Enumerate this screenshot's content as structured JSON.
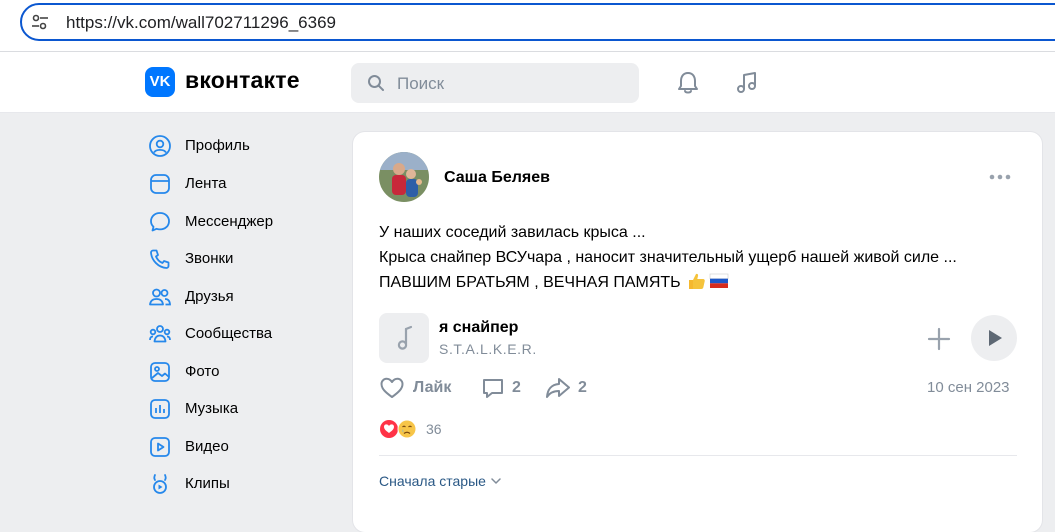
{
  "browser": {
    "url": "https://vk.com/wall702711296_6369"
  },
  "header": {
    "logo_letters": "VK",
    "brand": "вконтакте",
    "search_placeholder": "Поиск"
  },
  "sidebar": {
    "items": [
      {
        "label": "Профиль",
        "icon": "profile-icon"
      },
      {
        "label": "Лента",
        "icon": "feed-icon"
      },
      {
        "label": "Мессенджер",
        "icon": "messenger-icon"
      },
      {
        "label": "Звонки",
        "icon": "phone-icon"
      },
      {
        "label": "Друзья",
        "icon": "friends-icon"
      },
      {
        "label": "Сообщества",
        "icon": "communities-icon"
      },
      {
        "label": "Фото",
        "icon": "photo-icon"
      },
      {
        "label": "Музыка",
        "icon": "music-icon"
      },
      {
        "label": "Видео",
        "icon": "video-icon"
      },
      {
        "label": "Клипы",
        "icon": "clips-icon"
      }
    ]
  },
  "post": {
    "author": "Саша Беляев",
    "text_lines": [
      "У наших соседий завилась крыса ...",
      "Крыса снайпер ВСУчара , наносит значительный ущерб нашей живой силе ...",
      "ПАВШИМ БРАТЬЯМ , ВЕЧНАЯ ПАМЯТЬ"
    ],
    "audio": {
      "title": "я снайпер",
      "artist": "S.T.A.L.K.E.R."
    },
    "actions": {
      "like_label": "Лайк",
      "comments_count": "2",
      "shares_count": "2"
    },
    "date": "10 сен 2023",
    "reactions_count": "36",
    "sort_label": "Сначала старые"
  },
  "colors": {
    "accent": "#0077ff",
    "link": "#2a5885",
    "muted": "#818c99",
    "background": "#edeef0"
  }
}
